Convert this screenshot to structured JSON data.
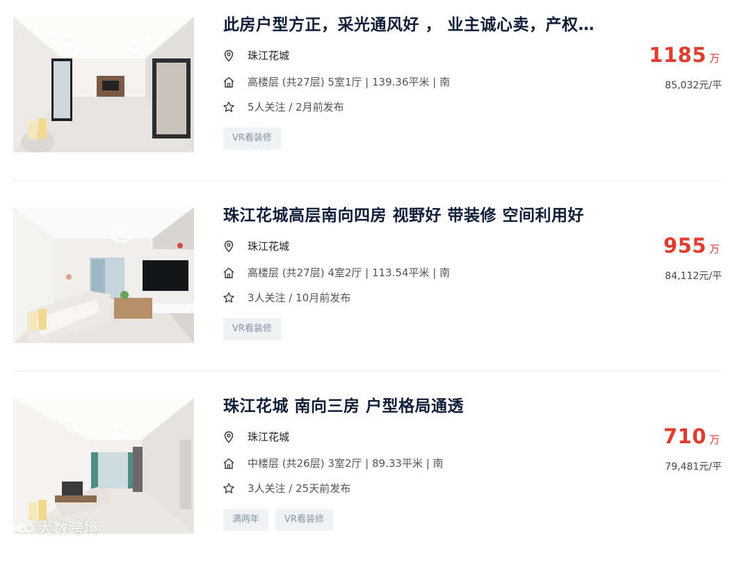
{
  "listings": [
    {
      "title": "此房户型方正，采光通风好 ， 业主诚心卖，产权…",
      "community": "珠江花城",
      "house_info": "高楼层 (共27层) 5室1厅 | 139.36平米 | 南",
      "follow_info": "5人关注 / 2月前发布",
      "tags": [
        "VR看装修"
      ],
      "total_price": "1185",
      "price_unit": "万",
      "unit_price": "85,032元/平"
    },
    {
      "title": "珠江花城高层南向四房 视野好 带装修 空间利用好",
      "community": "珠江花城",
      "house_info": "高楼层 (共27层) 4室2厅 | 113.54平米 | 南",
      "follow_info": "3人关注 / 10月前发布",
      "tags": [
        "VR看装修"
      ],
      "total_price": "955",
      "price_unit": "万",
      "unit_price": "84,112元/平"
    },
    {
      "title": "珠江花城 南向三房 户型格局通透",
      "community": "珠江花城",
      "house_info": "中楼层 (共26层) 3室2厅 | 89.33平米 | 南",
      "follow_info": "3人关注 / 25天前发布",
      "tags": [
        "满两年",
        "VR看装修"
      ],
      "total_price": "710",
      "price_unit": "万",
      "unit_price": "79,481元/平"
    }
  ],
  "watermark": "大数跨境",
  "colors": {
    "price": "#e03c2f",
    "title": "#101d37",
    "tag_bg": "#f0f3f6",
    "tag_text": "#8494a9"
  }
}
